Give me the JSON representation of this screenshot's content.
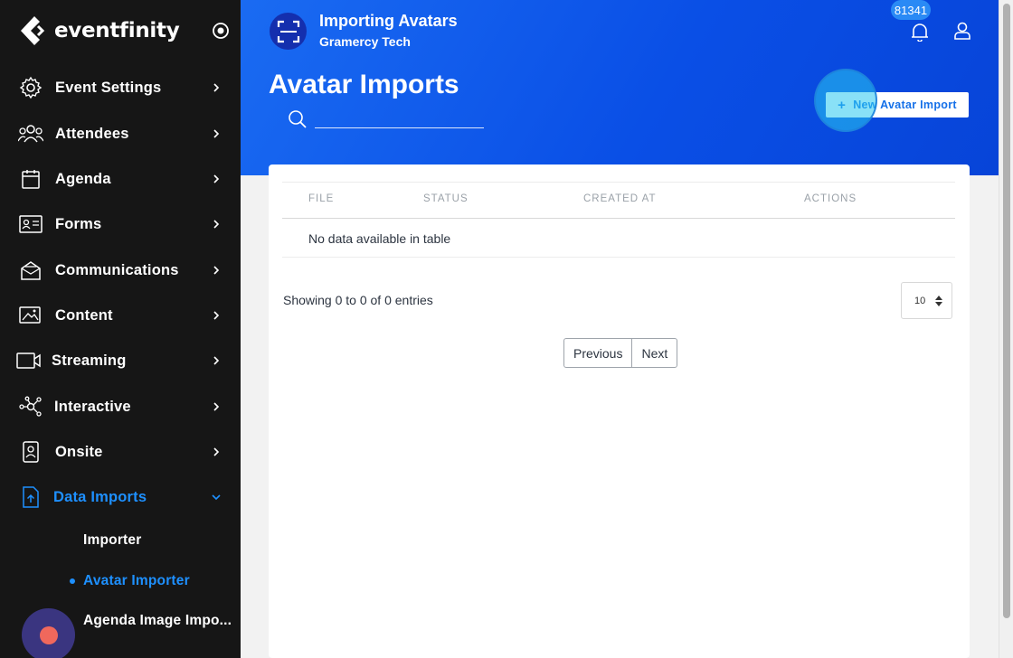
{
  "brand": {
    "name": "eventfinity",
    "accent": "#1e90ff"
  },
  "sidebar": {
    "items": [
      {
        "label": "Event Settings",
        "icon": "gear-icon"
      },
      {
        "label": "Attendees",
        "icon": "people-icon"
      },
      {
        "label": "Agenda",
        "icon": "calendar-icon"
      },
      {
        "label": "Forms",
        "icon": "form-icon"
      },
      {
        "label": "Communications",
        "icon": "mail-icon"
      },
      {
        "label": "Content",
        "icon": "image-icon"
      },
      {
        "label": "Streaming",
        "icon": "video-icon"
      },
      {
        "label": "Interactive",
        "icon": "network-icon"
      },
      {
        "label": "Onsite",
        "icon": "badge-icon"
      },
      {
        "label": "Data Imports",
        "icon": "file-upload-icon"
      }
    ],
    "sub_items": [
      {
        "label": "Importer"
      },
      {
        "label": "Avatar Importer"
      },
      {
        "label": "Agenda Image Impo..."
      }
    ]
  },
  "header": {
    "app_title": "Importing Avatars",
    "app_subtitle": "Gramercy Tech",
    "notification_count": "81341",
    "page_title": "Avatar Imports",
    "search_value": "",
    "new_button_label": "New Avatar Import"
  },
  "table": {
    "columns": [
      "FILE",
      "STATUS",
      "CREATED AT",
      "ACTIONS"
    ],
    "empty_message": "No data available in table",
    "info": "Showing 0 to 0 of 0 entries",
    "page_size": "10",
    "prev_label": "Previous",
    "next_label": "Next"
  }
}
